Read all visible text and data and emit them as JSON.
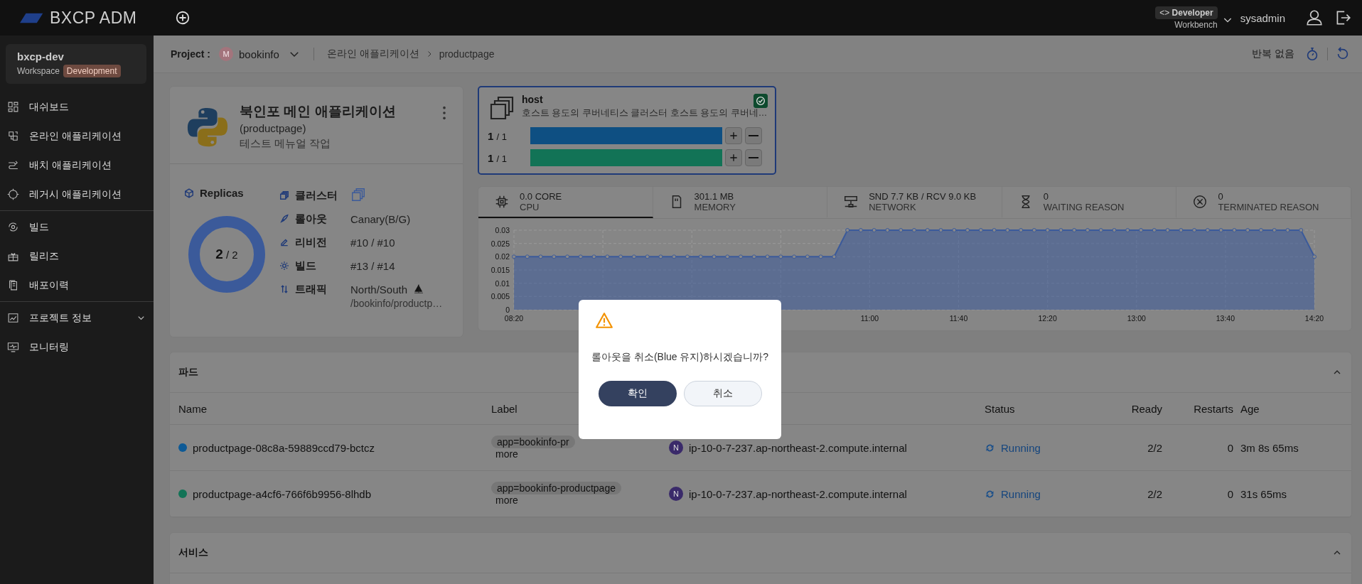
{
  "topbar": {
    "logo": "BXCP ADM",
    "role": {
      "title": "Developer",
      "code_mark": "<>",
      "subtitle": "Workbench"
    },
    "user": "sysadmin"
  },
  "sidebar": {
    "workspace": {
      "name": "bxcp-dev",
      "label": "Workspace",
      "tag": "Development"
    },
    "groups": [
      [
        {
          "label": "대쉬보드",
          "kind": "link"
        },
        {
          "label": "온라인 애플리케이션",
          "kind": "link"
        },
        {
          "label": "배치 애플리케이션",
          "kind": "link"
        },
        {
          "label": "레거시 애플리케이션",
          "kind": "link"
        }
      ],
      [
        {
          "label": "빌드",
          "kind": "link"
        },
        {
          "label": "릴리즈",
          "kind": "link"
        },
        {
          "label": "배포이력",
          "kind": "link"
        }
      ],
      [
        {
          "label": "프로젝트 정보",
          "kind": "group"
        },
        {
          "label": "모니터링",
          "kind": "link"
        }
      ]
    ]
  },
  "breadcrumb": {
    "project_label": "Project :",
    "project_avatar": "M",
    "project": "bookinfo",
    "path": [
      "온라인 애플리케이션",
      "productpage"
    ],
    "refresh": "반복 없음"
  },
  "app": {
    "title": "북인포 메인 애플리케이션",
    "subtitle": "(productpage)",
    "description": "테스트 메뉴얼 작업",
    "replicas": {
      "label": "Replicas",
      "current": "2",
      "total": "/ 2",
      "level": 1
    },
    "info": [
      {
        "label": "클러스터",
        "kind": "cluster"
      },
      {
        "label": "롤아웃",
        "kind": "text",
        "value": "Canary(B/G)"
      },
      {
        "label": "리비전",
        "kind": "text",
        "value": "#10 / #10"
      },
      {
        "label": "빌드",
        "kind": "text",
        "value": "#13 / #14"
      },
      {
        "label": "트래픽",
        "kind": "traffic",
        "value": "North/South",
        "sub": "/bookinfo/productp…"
      }
    ]
  },
  "host": {
    "name": "host",
    "description": "호스트 용도의 쿠버네티스 클러스터 호스트 용도의 쿠버네…",
    "checked": true,
    "bars": [
      {
        "count": "1",
        "total": "/ 1",
        "color": "#0e4f82",
        "level": 1
      },
      {
        "count": "1",
        "total": "/ 1",
        "color": "#127356",
        "level": 1
      }
    ]
  },
  "metrics": {
    "tabs": [
      {
        "value": "0.0 CORE",
        "label": "CPU",
        "selected": true
      },
      {
        "value": "301.1 MB",
        "label": "MEMORY",
        "selected": false
      },
      {
        "value": "SND 7.7 KB / RCV 9.0 KB",
        "label": "NETWORK",
        "selected": false
      },
      {
        "value": "0",
        "label": "WAITING REASON",
        "selected": false
      },
      {
        "value": "0",
        "label": "TERMINATED REASON",
        "selected": false
      }
    ],
    "chart_data": {
      "type": "area",
      "grid": true,
      "xlim": [
        500,
        860
      ],
      "ylim": [
        0,
        0.03
      ],
      "x": [
        500,
        506,
        512,
        518,
        524,
        530,
        536,
        542,
        548,
        554,
        560,
        566,
        572,
        578,
        584,
        590,
        596,
        602,
        608,
        614,
        620,
        626,
        632,
        638,
        644,
        650,
        656,
        662,
        668,
        674,
        680,
        686,
        692,
        698,
        704,
        710,
        716,
        722,
        728,
        734,
        740,
        746,
        752,
        758,
        764,
        770,
        776,
        782,
        788,
        794,
        800,
        806,
        812,
        818,
        824,
        830,
        836,
        842,
        848,
        854,
        860
      ],
      "series": [
        {
          "color": "#3b5a9a",
          "values": [
            0.02,
            0.02,
            0.02,
            0.02,
            0.02,
            0.02,
            0.02,
            0.02,
            0.02,
            0.02,
            0.02,
            0.02,
            0.02,
            0.02,
            0.02,
            0.02,
            0.02,
            0.02,
            0.02,
            0.02,
            0.02,
            0.02,
            0.02,
            0.02,
            0.02,
            0.03,
            0.03,
            0.03,
            0.03,
            0.03,
            0.03,
            0.03,
            0.03,
            0.03,
            0.03,
            0.03,
            0.03,
            0.03,
            0.03,
            0.03,
            0.03,
            0.03,
            0.03,
            0.03,
            0.03,
            0.03,
            0.03,
            0.03,
            0.03,
            0.03,
            0.03,
            0.03,
            0.03,
            0.03,
            0.03,
            0.03,
            0.03,
            0.03,
            0.03,
            0.03,
            0.02
          ]
        }
      ],
      "xticks": [
        {
          "value": 500,
          "label": "08:20"
        },
        {
          "value": 660,
          "label": "11:00"
        },
        {
          "value": 700,
          "label": "11:40"
        },
        {
          "value": 740,
          "label": "12:20"
        },
        {
          "value": 780,
          "label": "13:00"
        },
        {
          "value": 820,
          "label": "13:40"
        },
        {
          "value": 860,
          "label": "14:20"
        }
      ],
      "yticks": [
        0,
        0.005,
        0.01,
        0.015,
        0.02,
        0.025,
        0.03
      ]
    }
  },
  "pods": {
    "title": "파드",
    "expanded": true,
    "columns": [
      "Name",
      "Label",
      "Status",
      "Ready",
      "Restarts",
      "Age"
    ],
    "rows": [
      {
        "color": "#0e5a96",
        "name": "productpage-08c8a-59889ccd79-bctcz",
        "label": "app=bookinfo-pr",
        "more": "more",
        "node_badge": "N",
        "node": "ip-10-0-7-237.ap-northeast-2.compute.internal",
        "status": "Running",
        "ready": "2/2",
        "restarts": "0",
        "age": "3m 8s 65ms"
      },
      {
        "color": "#127356",
        "name": "productpage-a4cf6-766f6b9956-8lhdb",
        "label": "app=bookinfo-productpage",
        "more": "more",
        "node_badge": "N",
        "node": "ip-10-0-7-237.ap-northeast-2.compute.internal",
        "status": "Running",
        "ready": "2/2",
        "restarts": "0",
        "age": "31s 65ms"
      }
    ]
  },
  "services": {
    "title": "서비스",
    "expanded": true
  },
  "dialog": {
    "message": "롤아웃을 취소(Blue 유지)하시겠습니까?",
    "buttons": [
      {
        "label": "확인",
        "kind": "primary"
      },
      {
        "label": "취소",
        "kind": "secondary"
      }
    ]
  }
}
